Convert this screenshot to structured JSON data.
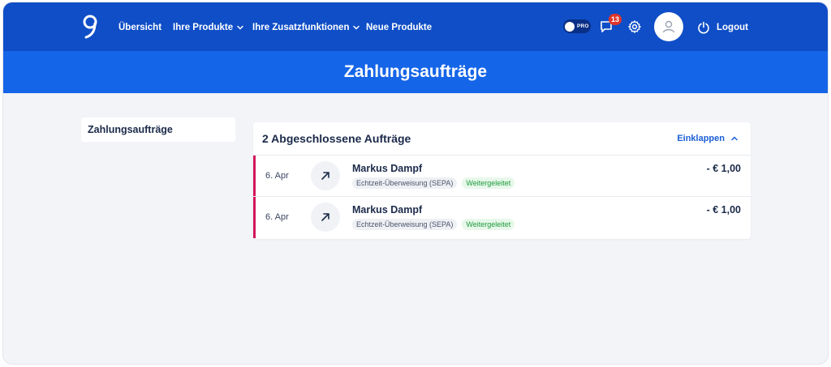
{
  "nav": {
    "items": [
      {
        "label": "Übersicht",
        "has_dropdown": false
      },
      {
        "label": "Ihre Produkte",
        "has_dropdown": true
      },
      {
        "label": "Ihre Zusatzfunktionen",
        "has_dropdown": true
      },
      {
        "label": "Neue Produkte",
        "has_dropdown": false
      }
    ],
    "pro_label": "PRO",
    "messages_badge": "13",
    "logout_label": "Logout",
    "icons": [
      "logo-icon",
      "chat-icon",
      "gear-icon",
      "user-icon",
      "power-icon",
      "chevron-down-icon"
    ]
  },
  "banner": {
    "title": "Zahlungsaufträge"
  },
  "sidebar": {
    "items": [
      {
        "label": "Zahlungsaufträge"
      }
    ]
  },
  "card": {
    "title": "2 Abgeschlossene Aufträge",
    "collapse_label": "Einklappen",
    "rows": [
      {
        "date": "6. Apr",
        "name": "Markus Dampf",
        "method": "Echtzeit-Überweisung (SEPA)",
        "status": "Weitergeleitet",
        "amount": "- € 1,00"
      },
      {
        "date": "6. Apr",
        "name": "Markus Dampf",
        "method": "Echtzeit-Überweisung (SEPA)",
        "status": "Weitergeleitet",
        "amount": "- € 1,00"
      }
    ]
  },
  "colors": {
    "nav_bg": "#0f4ec7",
    "banner_bg": "#1565e8",
    "accent_bar": "#d4145a",
    "badge": "#e0352b",
    "status_green": "#1f9a3e",
    "link_blue": "#1a5fd6"
  }
}
